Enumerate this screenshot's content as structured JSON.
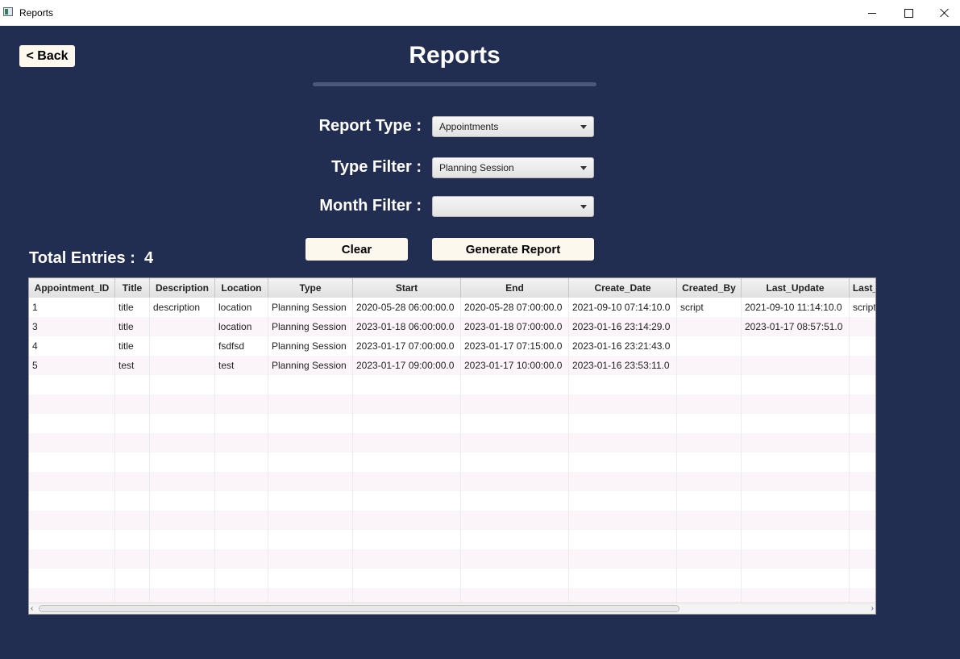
{
  "window": {
    "title": "Reports"
  },
  "back_label": "< Back",
  "page_title": "Reports",
  "form": {
    "report_type_label": "Report Type :",
    "report_type_value": "Appointments",
    "type_filter_label": "Type Filter :",
    "type_filter_value": "Planning Session",
    "month_filter_label": "Month Filter :",
    "month_filter_value": ""
  },
  "buttons": {
    "clear": "Clear",
    "generate": "Generate Report"
  },
  "total": {
    "label": "Total Entries :",
    "value": "4"
  },
  "table": {
    "columns": [
      "Appointment_ID",
      "Title",
      "Description",
      "Location",
      "Type",
      "Start",
      "End",
      "Create_Date",
      "Created_By",
      "Last_Update",
      "Last_"
    ],
    "rows": [
      [
        "1",
        "title",
        "description",
        "location",
        "Planning Session",
        "2020-05-28 06:00:00.0",
        "2020-05-28 07:00:00.0",
        "2021-09-10 07:14:10.0",
        "script",
        "2021-09-10 11:14:10.0",
        "script"
      ],
      [
        "3",
        "title",
        "",
        "location",
        "Planning Session",
        "2023-01-18 06:00:00.0",
        "2023-01-18 07:00:00.0",
        "2023-01-16 23:14:29.0",
        "",
        "2023-01-17 08:57:51.0",
        ""
      ],
      [
        "4",
        "title",
        "",
        "fsdfsd",
        "Planning Session",
        "2023-01-17 07:00:00.0",
        "2023-01-17 07:15:00.0",
        "2023-01-16 23:21:43.0",
        "",
        "",
        ""
      ],
      [
        "5",
        "test",
        "",
        "test",
        "Planning Session",
        "2023-01-17 09:00:00.0",
        "2023-01-17 10:00:00.0",
        "2023-01-16 23:53:11.0",
        "",
        "",
        ""
      ]
    ],
    "empty_rows": 12
  }
}
